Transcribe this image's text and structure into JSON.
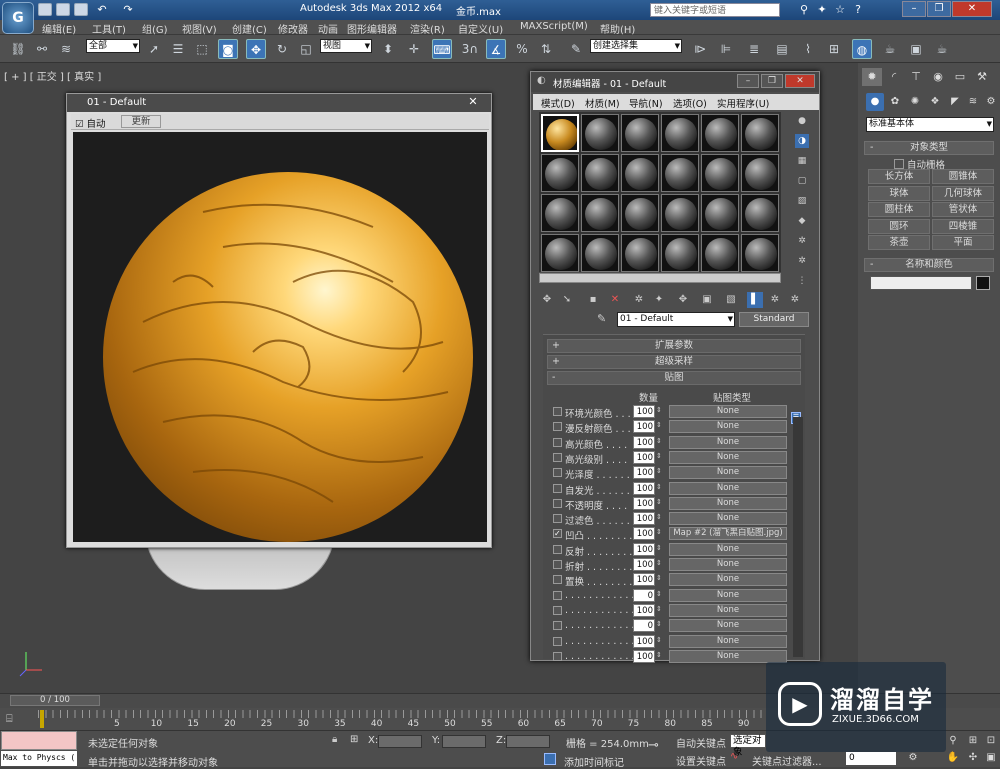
{
  "app": {
    "title": "Autodesk 3ds Max  2012 x64",
    "filename": "金币.max",
    "search_placeholder": "键入关键字或短语"
  },
  "menu": [
    "编辑(E)",
    "工具(T)",
    "组(G)",
    "视图(V)",
    "创建(C)",
    "修改器",
    "动画",
    "图形编辑器",
    "渲染(R)",
    "自定义(U)",
    "MAXScript(M)",
    "帮助(H)"
  ],
  "toolbar": {
    "selection_filter": "全部",
    "ref_coord": "视图",
    "named_selection": "创建选择集",
    "snap_label": "3"
  },
  "viewport": {
    "label": "[ + ] [ 正交 ] [ 真实 ]"
  },
  "render_window": {
    "title": "01 - Default",
    "auto_label": "自动",
    "update_label": "更新",
    "close": "✕"
  },
  "material_editor": {
    "title": "材质编辑器 - 01 - Default",
    "menu": [
      "模式(D)",
      "材质(M)",
      "导航(N)",
      "选项(O)",
      "实用程序(U)"
    ],
    "material_name": "01 - Default",
    "material_type": "Standard",
    "rollouts": [
      {
        "sign": "+",
        "label": "扩展参数"
      },
      {
        "sign": "+",
        "label": "超级采样"
      },
      {
        "sign": "-",
        "label": "贴图"
      }
    ],
    "map_header_amount": "数量",
    "map_header_type": "贴图类型",
    "maps": [
      {
        "checked": false,
        "label": "环境光颜色 . . .",
        "amount": "100",
        "map": "None"
      },
      {
        "checked": false,
        "label": "漫反射颜色 . . .",
        "amount": "100",
        "map": "None"
      },
      {
        "checked": false,
        "label": "高光颜色 . . . .",
        "amount": "100",
        "map": "None"
      },
      {
        "checked": false,
        "label": "高光级别 . . . .",
        "amount": "100",
        "map": "None"
      },
      {
        "checked": false,
        "label": "光泽度 . . . . . .",
        "amount": "100",
        "map": "None"
      },
      {
        "checked": false,
        "label": "自发光 . . . . . .",
        "amount": "100",
        "map": "None"
      },
      {
        "checked": false,
        "label": "不透明度 . . . .",
        "amount": "100",
        "map": "None"
      },
      {
        "checked": false,
        "label": "过滤色 . . . . . .",
        "amount": "100",
        "map": "None"
      },
      {
        "checked": true,
        "label": "凹凸 . . . . . . . .",
        "amount": "100",
        "map": "Map #2 (溜飞黑白贴图.jpg)"
      },
      {
        "checked": false,
        "label": "反射 . . . . . . . .",
        "amount": "100",
        "map": "None"
      },
      {
        "checked": false,
        "label": "折射 . . . . . . . .",
        "amount": "100",
        "map": "None"
      },
      {
        "checked": false,
        "label": "置换 . . . . . . . .",
        "amount": "100",
        "map": "None"
      },
      {
        "checked": false,
        "label": ". . . . . . . . . . . .",
        "amount": "0",
        "map": "None"
      },
      {
        "checked": false,
        "label": ". . . . . . . . . . . .",
        "amount": "100",
        "map": "None"
      },
      {
        "checked": false,
        "label": ". . . . . . . . . . . .",
        "amount": "0",
        "map": "None"
      },
      {
        "checked": false,
        "label": ". . . . . . . . . . . .",
        "amount": "100",
        "map": "None"
      },
      {
        "checked": false,
        "label": ". . . . . . . . . . . .",
        "amount": "100",
        "map": "None"
      }
    ]
  },
  "command_panel": {
    "dropdown": "标准基本体",
    "object_type_header": "对象类型",
    "auto_grid": "自动栅格",
    "objects": [
      "长方体",
      "圆锥体",
      "球体",
      "几何球体",
      "圆柱体",
      "管状体",
      "圆环",
      "四棱锥",
      "茶壶",
      "平面"
    ],
    "name_color_header": "名称和颜色"
  },
  "timeline": {
    "slider_label": "0 / 100",
    "ticks": [
      "5",
      "10",
      "15",
      "20",
      "25",
      "30",
      "35",
      "40",
      "45",
      "50",
      "55",
      "60",
      "65",
      "70",
      "75",
      "80",
      "85",
      "90"
    ]
  },
  "status": {
    "maxscript": "Max to Physcs (",
    "selection": "未选定任何对象",
    "prompt": "单击并拖动以选择并移动对象",
    "x_label": "X:",
    "y_label": "Y:",
    "z_label": "Z:",
    "grid": "栅格 = 254.0mm",
    "add_time_tag": "添加时间标记",
    "auto_key": "自动关键点",
    "selected_obj": "选定对象",
    "set_key": "设置关键点",
    "key_filters": "关键点过滤器...",
    "frame": "0"
  },
  "watermark": {
    "brand": "溜溜自学",
    "url": "ZIXUE.3D66.COM"
  }
}
